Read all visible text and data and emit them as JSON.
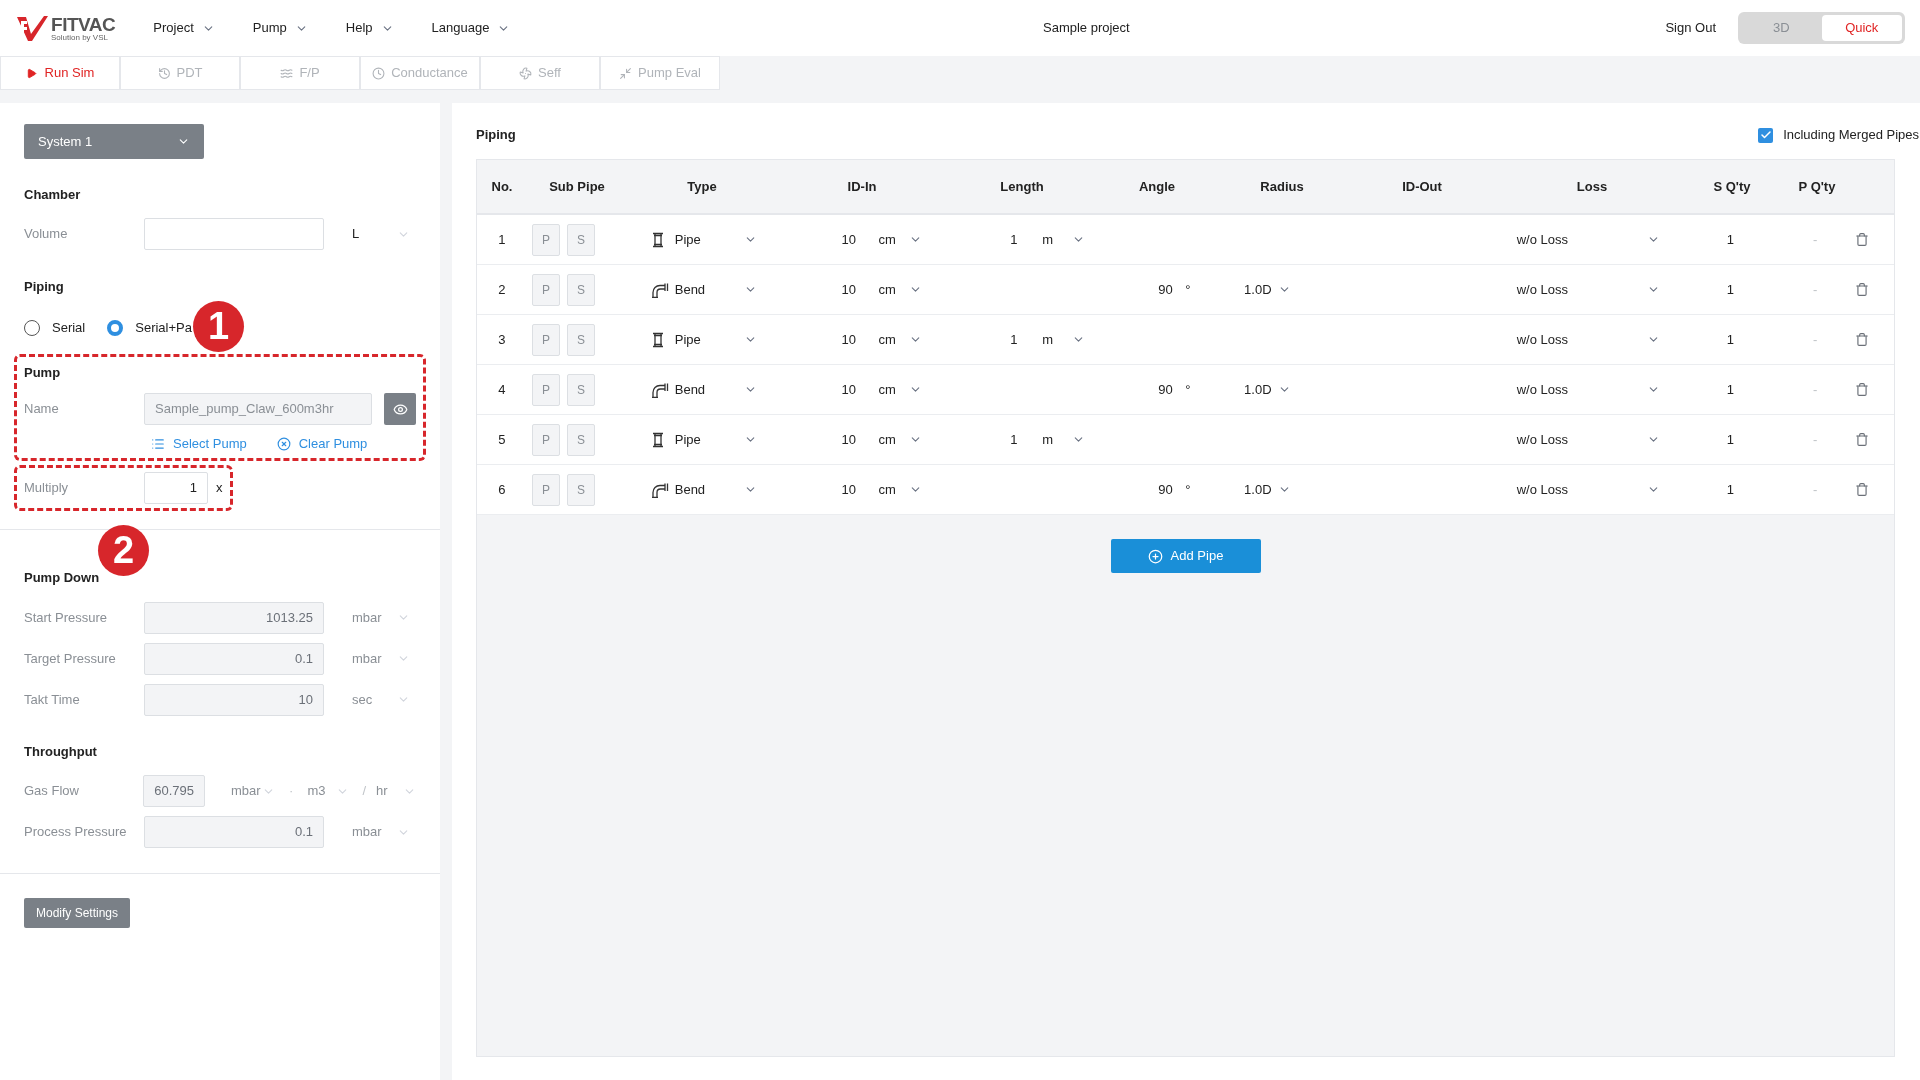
{
  "header": {
    "logo": {
      "name": "FITVAC",
      "tagline": "Solution by VSL"
    },
    "menu": [
      {
        "label": "Project"
      },
      {
        "label": "Pump"
      },
      {
        "label": "Help"
      },
      {
        "label": "Language"
      }
    ],
    "project_title": "Sample project",
    "sign_out": "Sign Out",
    "mode_toggle": [
      {
        "label": "3D",
        "selected": false
      },
      {
        "label": "Quick",
        "selected": true
      }
    ]
  },
  "toolbar": [
    {
      "label": "Run Sim",
      "disabled": false
    },
    {
      "label": "PDT",
      "disabled": true
    },
    {
      "label": "F/P",
      "disabled": true
    },
    {
      "label": "Conductance",
      "disabled": true
    },
    {
      "label": "Seff",
      "disabled": true
    },
    {
      "label": "Pump Eval",
      "disabled": true
    }
  ],
  "sidebar": {
    "system_select": "System 1",
    "chamber": {
      "title": "Chamber",
      "fields": [
        {
          "label": "Volume",
          "units": [
            "L"
          ],
          "disabled": false
        }
      ]
    },
    "piping": {
      "title": "Piping",
      "options": [
        {
          "label": "Serial",
          "selected": false
        },
        {
          "label": "Serial+Pa",
          "selected": true
        }
      ]
    },
    "pump": {
      "title": "Pump",
      "name_label": "Name",
      "name_value": "Sample_pump_Claw_600m3hr",
      "actions": [
        {
          "label": "Select Pump"
        },
        {
          "label": "Clear Pump"
        }
      ],
      "multiply": {
        "label": "Multiply",
        "value": "1",
        "suffix": "x"
      }
    },
    "annotations": [
      {
        "label": "1"
      },
      {
        "label": "2"
      }
    ],
    "pump_down_time": {
      "title": "Pump Down",
      "fields": [
        {
          "label": "Start Pressure",
          "value": "1013.25",
          "units": [
            "mbar"
          ],
          "disabled": true
        },
        {
          "label": "Target Pressure",
          "value": "0.1",
          "units": [
            "mbar"
          ],
          "disabled": true
        },
        {
          "label": "Takt Time",
          "value": "10",
          "units": [
            "sec"
          ],
          "disabled": true
        }
      ]
    },
    "throughput": {
      "title": "Throughput",
      "fields": [
        {
          "label": "Gas Flow",
          "value": "60.795",
          "units": [
            "mbar",
            "m3",
            "hr"
          ],
          "separators": [
            "·",
            "/"
          ],
          "disabled": true
        },
        {
          "label": "Process Pressure",
          "value": "0.1",
          "units": [
            "mbar"
          ],
          "disabled": true
        }
      ]
    },
    "modify_button": "Modify Settings"
  },
  "piping_table": {
    "title": "Piping",
    "merged_checkbox": {
      "label": "Including Merged Pipes",
      "checked": true
    },
    "columns": [
      "No.",
      "Sub Pipe",
      "Type",
      "ID-In",
      "Length",
      "Angle",
      "Radius",
      "ID-Out",
      "Loss",
      "S Q'ty",
      "P Q'ty"
    ],
    "rows": [
      {
        "no": "1",
        "sub_pipe": [
          "P",
          "S"
        ],
        "kind": "pipe",
        "type": "Pipe",
        "id_in": "10",
        "id_in_unit": "cm",
        "length": "1",
        "length_unit": "m",
        "loss": "w/o Loss",
        "s_qty": "1",
        "p_qty": "-"
      },
      {
        "no": "2",
        "sub_pipe": [
          "P",
          "S"
        ],
        "kind": "bend",
        "type": "Bend",
        "id_in": "10",
        "id_in_unit": "cm",
        "angle": "90",
        "angle_unit": "°",
        "radius": "1.0D",
        "loss": "w/o Loss",
        "s_qty": "1",
        "p_qty": "-"
      },
      {
        "no": "3",
        "sub_pipe": [
          "P",
          "S"
        ],
        "kind": "pipe",
        "type": "Pipe",
        "id_in": "10",
        "id_in_unit": "cm",
        "length": "1",
        "length_unit": "m",
        "loss": "w/o Loss",
        "s_qty": "1",
        "p_qty": "-"
      },
      {
        "no": "4",
        "sub_pipe": [
          "P",
          "S"
        ],
        "kind": "bend",
        "type": "Bend",
        "id_in": "10",
        "id_in_unit": "cm",
        "angle": "90",
        "angle_unit": "°",
        "radius": "1.0D",
        "loss": "w/o Loss",
        "s_qty": "1",
        "p_qty": "-"
      },
      {
        "no": "5",
        "sub_pipe": [
          "P",
          "S"
        ],
        "kind": "pipe",
        "type": "Pipe",
        "id_in": "10",
        "id_in_unit": "cm",
        "length": "1",
        "length_unit": "m",
        "loss": "w/o Loss",
        "s_qty": "1",
        "p_qty": "-"
      },
      {
        "no": "6",
        "sub_pipe": [
          "P",
          "S"
        ],
        "kind": "bend",
        "type": "Bend",
        "id_in": "10",
        "id_in_unit": "cm",
        "angle": "90",
        "angle_unit": "°",
        "radius": "1.0D",
        "loss": "w/o Loss",
        "s_qty": "1",
        "p_qty": "-"
      }
    ],
    "add_button": "Add Pipe"
  }
}
